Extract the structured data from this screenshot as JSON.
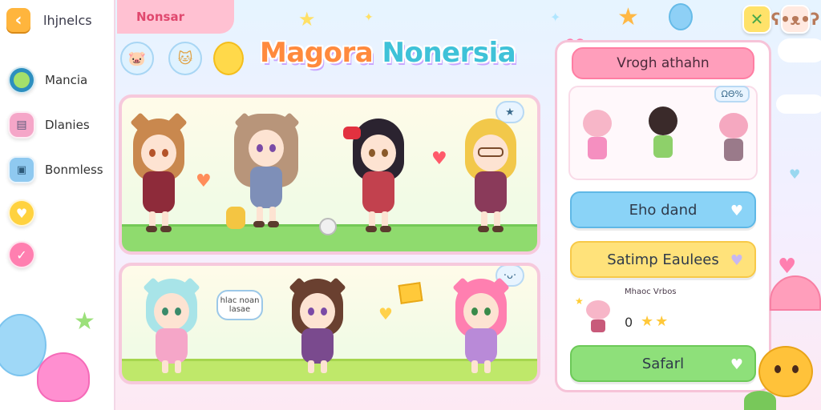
{
  "sidebar": {
    "back_label": "lhjnelcs",
    "items": [
      {
        "label": "Mancia",
        "color": "#7ed957"
      },
      {
        "label": "Dlanies",
        "color": "#f5a6c8"
      },
      {
        "label": "Bonmless",
        "color": "#8fc9f0"
      },
      {
        "label": "",
        "color": "#ffd23f"
      },
      {
        "label": "",
        "color": "#ff7fb0"
      }
    ]
  },
  "topbar": {
    "tab_label": "Nonsar",
    "title_part1": "Magora",
    "title_part2": "Nonersia",
    "close_glyph": "✕"
  },
  "scene1": {
    "badge": "★"
  },
  "scene2": {
    "badge": "·ᴗ·",
    "speech": "hlac noan lasae"
  },
  "right_panel": {
    "header": "Vrogh athahn",
    "badge": "ΩΘ%",
    "buttons": [
      {
        "label": "Eho dand",
        "bg": "#8ad3f7",
        "border": "#5fb8e6"
      },
      {
        "label": "Satimp Eaulees",
        "bg": "#ffe27a",
        "border": "#f7c948"
      },
      {
        "label": "Safarl",
        "bg": "#8ee07a",
        "border": "#6cc958"
      }
    ],
    "list_title": "Mhaoc Vrbos",
    "list_count": "0",
    "list_stars": "★★"
  }
}
